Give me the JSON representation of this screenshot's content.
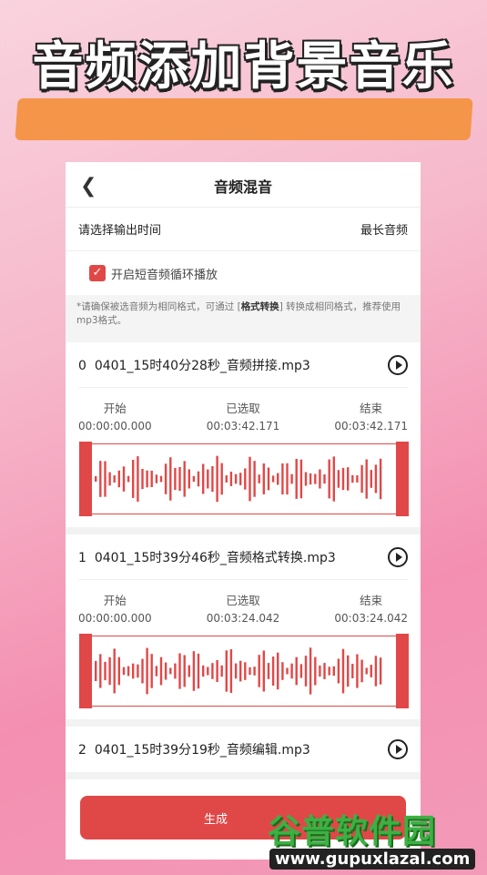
{
  "promo": {
    "title": "音频添加背景音乐"
  },
  "nav": {
    "title": "音频混音"
  },
  "output": {
    "label": "请选择输出时间",
    "value": "最长音频"
  },
  "loop": {
    "label": "开启短音频循环播放",
    "checked": true
  },
  "note": {
    "prefix": "*请确保被选音频为相同格式，可通过 [",
    "link": "格式转换",
    "suffix": "] 转换成相同格式，推荐使用mp3格式。"
  },
  "time_labels": {
    "start": "开始",
    "selected": "已选取",
    "end": "结束"
  },
  "tracks": [
    {
      "index": "0",
      "name": "0401_15时40分28秒_音频拼接.mp3",
      "start": "00:00:00.000",
      "selected": "00:03:42.171",
      "end": "00:03:42.171"
    },
    {
      "index": "1",
      "name": "0401_15时39分46秒_音频格式转换.mp3",
      "start": "00:00:00.000",
      "selected": "00:03:24.042",
      "end": "00:03:24.042"
    },
    {
      "index": "2",
      "name": "0401_15时39分19秒_音频编辑.mp3"
    }
  ],
  "generate_label": "生成",
  "watermark": {
    "cn": "谷普软件园",
    "url": "www.gupuxlazal.com"
  },
  "colors": {
    "accent": "#e04848",
    "promo_band": "#f5954a",
    "watermark_green": "#3cb043"
  }
}
